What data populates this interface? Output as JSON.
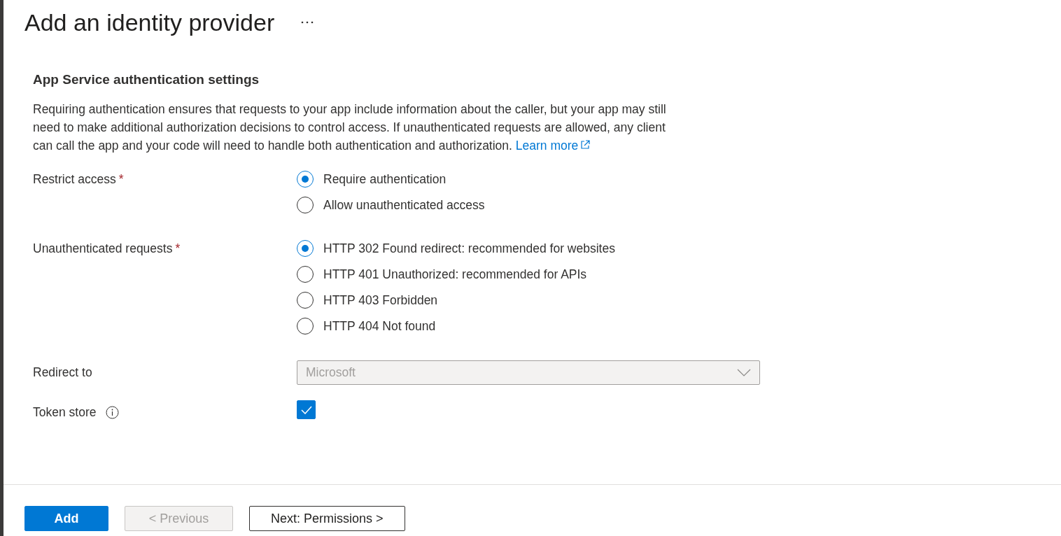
{
  "title": "Add an identity provider",
  "section": {
    "heading": "App Service authentication settings",
    "description": "Requiring authentication ensures that requests to your app include information about the caller, but your app may still need to make additional authorization decisions to control access. If unauthenticated requests are allowed, any client can call the app and your code will need to handle both authentication and authorization.",
    "link": "Learn more"
  },
  "fields": [
    {
      "kind": "radio",
      "label": "Restrict access",
      "required_mark": "*",
      "options": [
        {
          "label": "Require authentication",
          "selected": true
        },
        {
          "label": "Allow unauthenticated access",
          "selected": false
        }
      ]
    },
    {
      "kind": "radio",
      "label": "Unauthenticated requests",
      "required_mark": "*",
      "options": [
        {
          "label": "HTTP 302 Found redirect: recommended for websites",
          "selected": true
        },
        {
          "label": "HTTP 401 Unauthorized: recommended for APIs",
          "selected": false
        },
        {
          "label": "HTTP 403 Forbidden",
          "selected": false
        },
        {
          "label": "HTTP 404 Not found",
          "selected": false
        }
      ]
    },
    {
      "kind": "dropdown",
      "label": "Redirect to",
      "value": "Microsoft",
      "disabled": true
    },
    {
      "kind": "checkbox",
      "label": "Token store",
      "info": true,
      "checked": true
    }
  ],
  "buttons": [
    {
      "label": "Add",
      "primary": true,
      "disabled": false
    },
    {
      "label": "< Previous",
      "primary": false,
      "disabled": true
    },
    {
      "label": "Next: Permissions >",
      "primary": false,
      "disabled": false
    }
  ]
}
